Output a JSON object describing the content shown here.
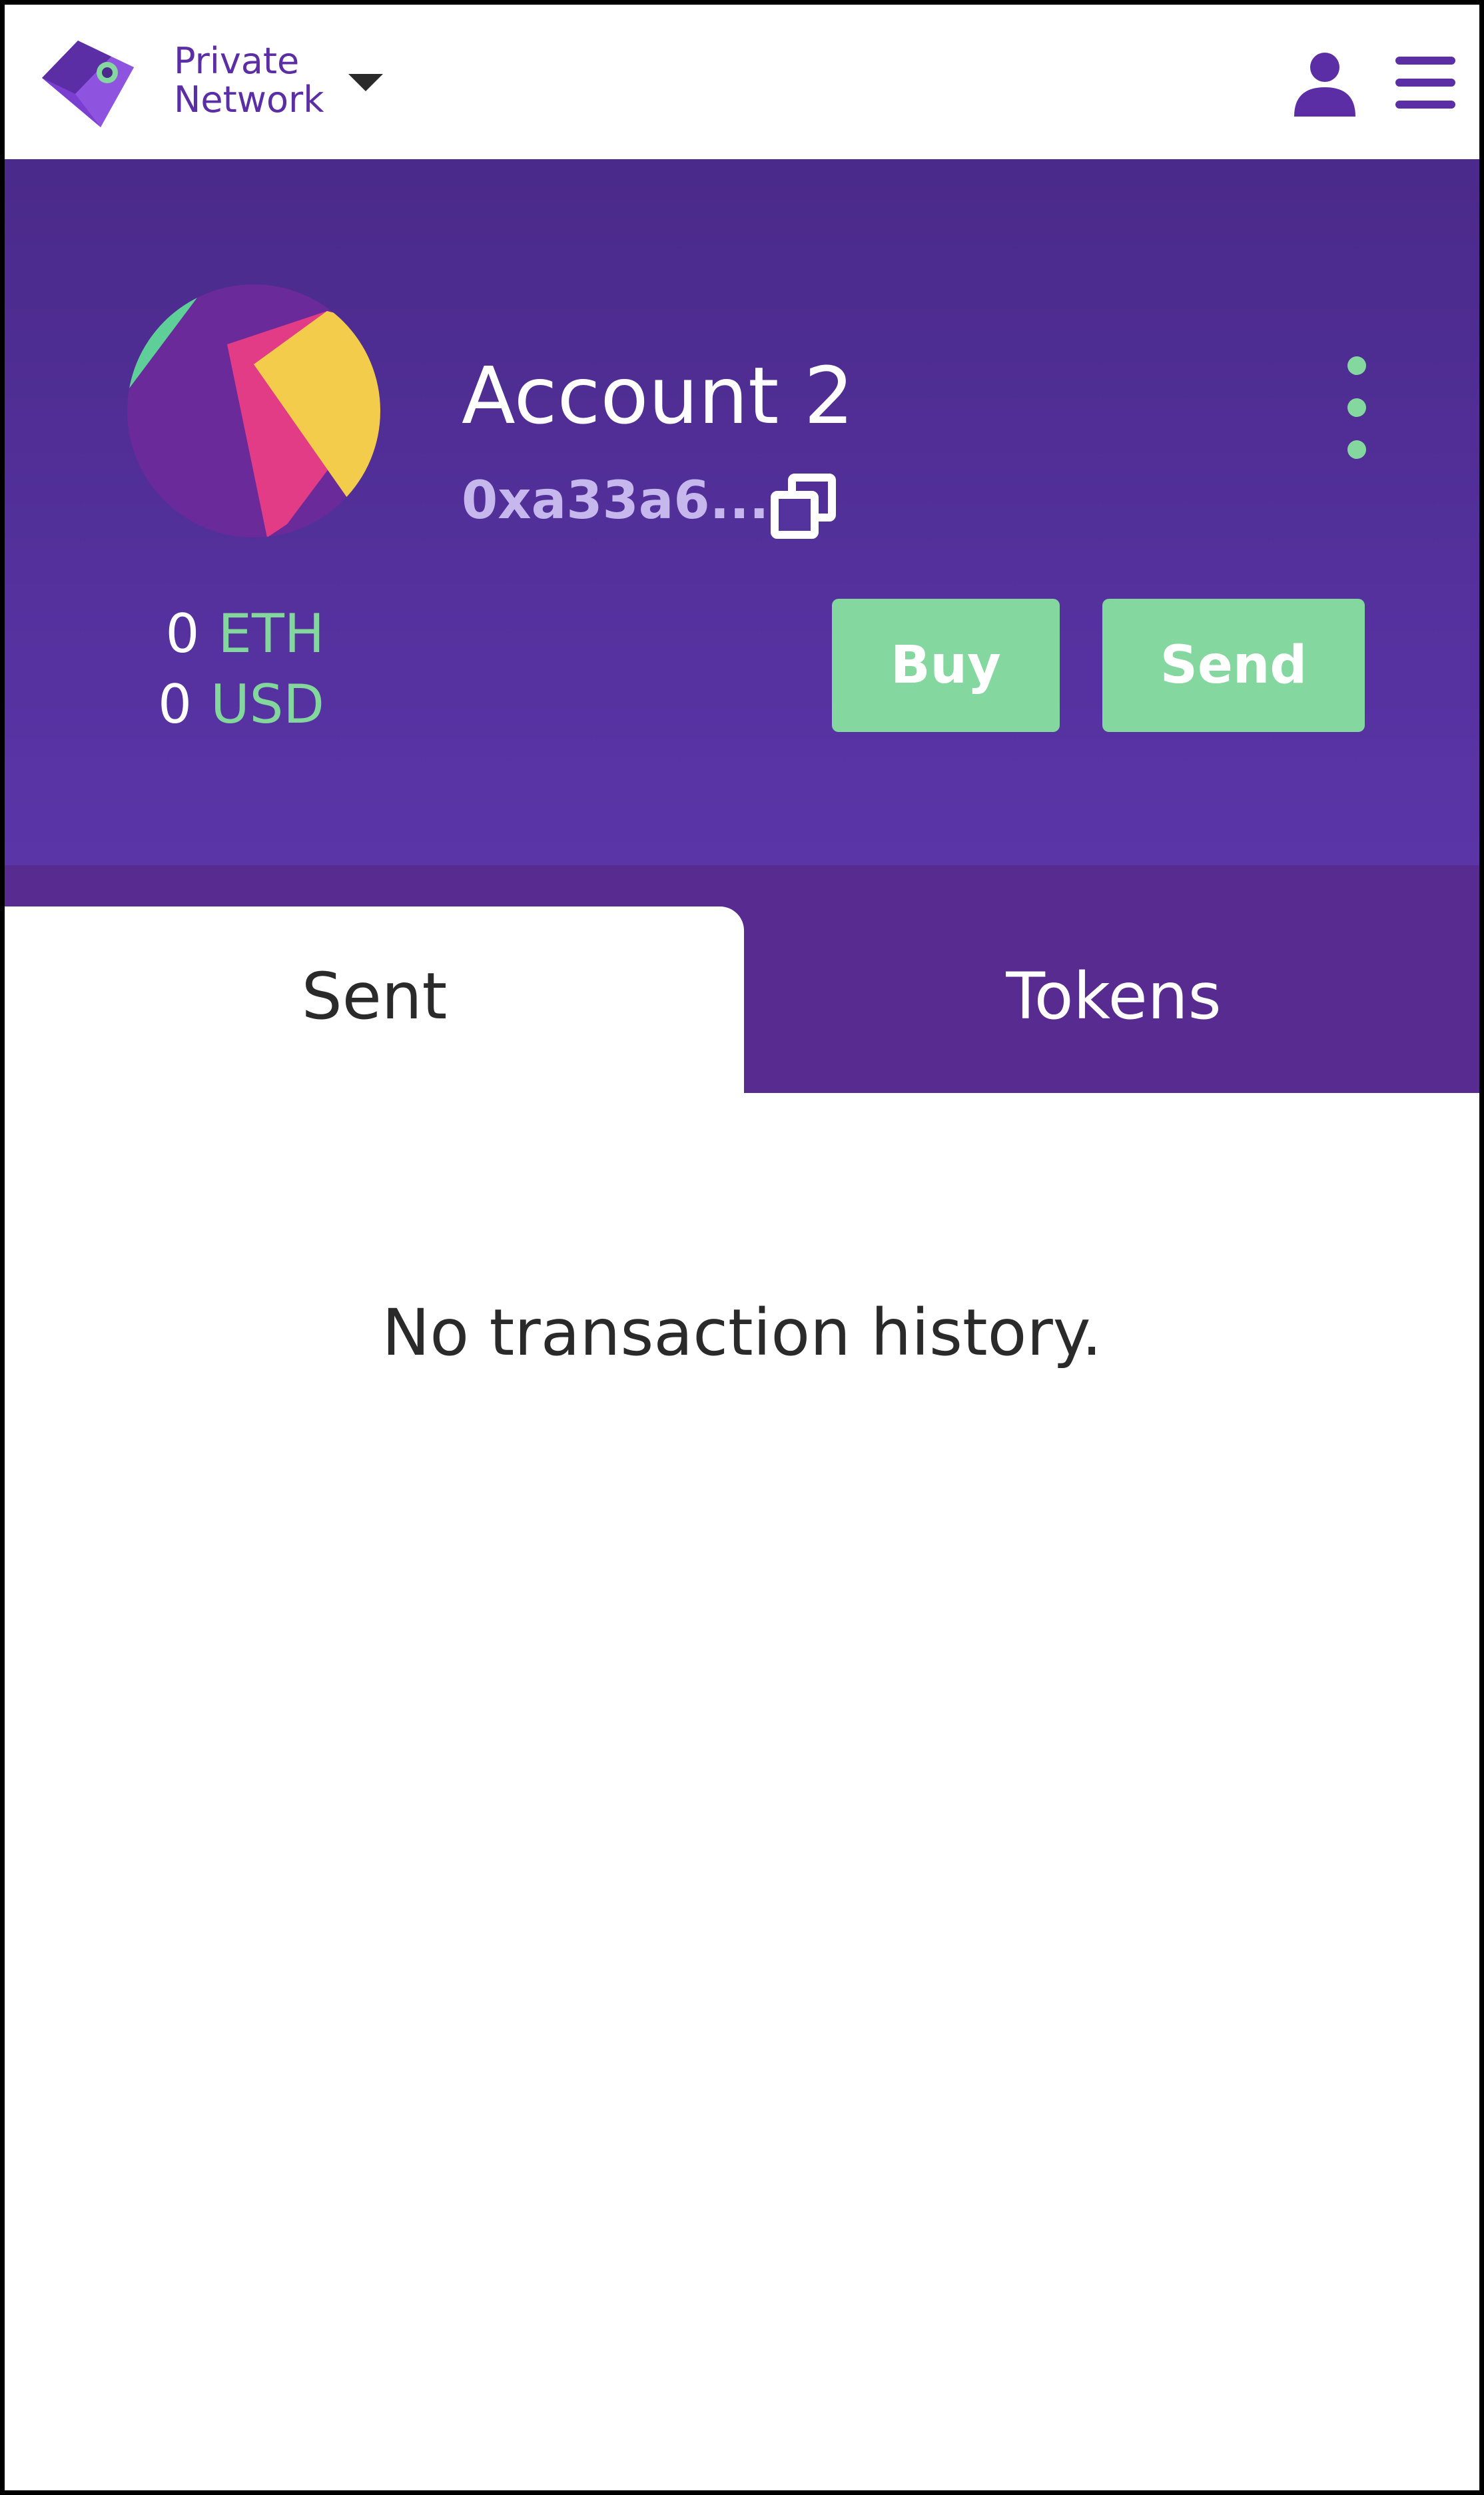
{
  "network": {
    "line1": "Private",
    "line2": "Network"
  },
  "account": {
    "name": "Account 2",
    "address": "0xa33a6...",
    "balances": [
      {
        "amount": "0",
        "unit": "ETH"
      },
      {
        "amount": "0",
        "unit": "USD"
      }
    ]
  },
  "actions": {
    "buy_label": "Buy",
    "send_label": "Send"
  },
  "tabs": {
    "sent_label": "Sent",
    "tokens_label": "Tokens"
  },
  "content": {
    "empty_message": "No transaction history."
  },
  "icons": {
    "logo": "wallet-logo-icon",
    "network_dropdown": "caret-down-icon",
    "profile": "user-icon",
    "menu": "hamburger-menu-icon",
    "copy": "copy-icon",
    "more": "kebab-menu-icon"
  },
  "colors": {
    "brand_purple": "#5a35a8",
    "tab_bar_purple": "#572b8f",
    "accent_green": "#84d79e",
    "address_lavender": "#c6b7ec"
  }
}
